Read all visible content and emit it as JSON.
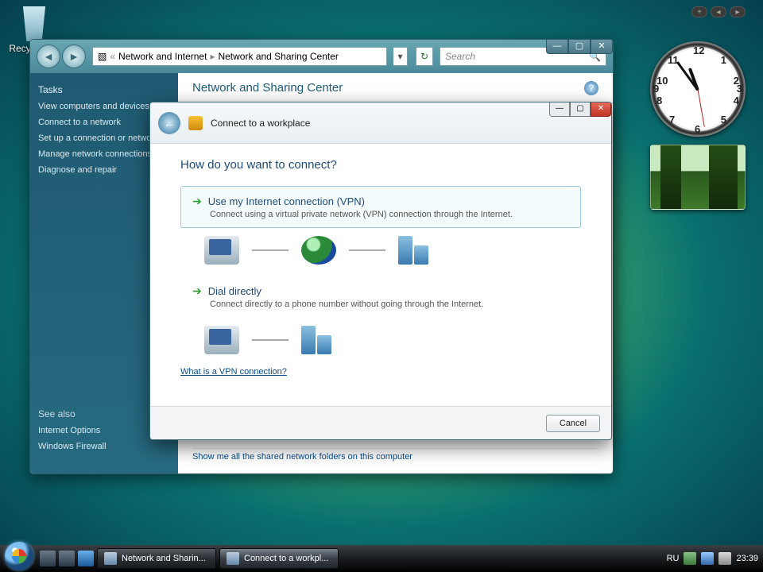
{
  "desktop": {
    "recycle_bin": "Recycle Bin"
  },
  "gadgets": {
    "add": "+"
  },
  "explorer": {
    "breadcrumb1": "Network and Internet",
    "breadcrumb2": "Network and Sharing Center",
    "search_placeholder": "Search",
    "tasks_heading": "Tasks",
    "tasks": [
      "View computers and devices",
      "Connect to a network",
      "Set up a connection or network",
      "Manage network connections",
      "Diagnose and repair"
    ],
    "seealso_heading": "See also",
    "seealso": [
      "Internet Options",
      "Windows Firewall"
    ],
    "content_title": "Network and Sharing Center",
    "shared_link": "Show me all the shared network folders on this computer"
  },
  "wizard": {
    "window_title": "Connect to a workplace",
    "heading": "How do you want to connect?",
    "option1_title": "Use my Internet connection (VPN)",
    "option1_desc": "Connect using a virtual private network (VPN) connection through the Internet.",
    "option2_title": "Dial directly",
    "option2_desc": "Connect directly to a phone number without going through the Internet.",
    "vpn_link": "What is a VPN connection?",
    "cancel": "Cancel"
  },
  "taskbar": {
    "item1": "Network and Sharin...",
    "item2": "Connect to a workpl...",
    "language": "RU",
    "clock": "23:39"
  }
}
